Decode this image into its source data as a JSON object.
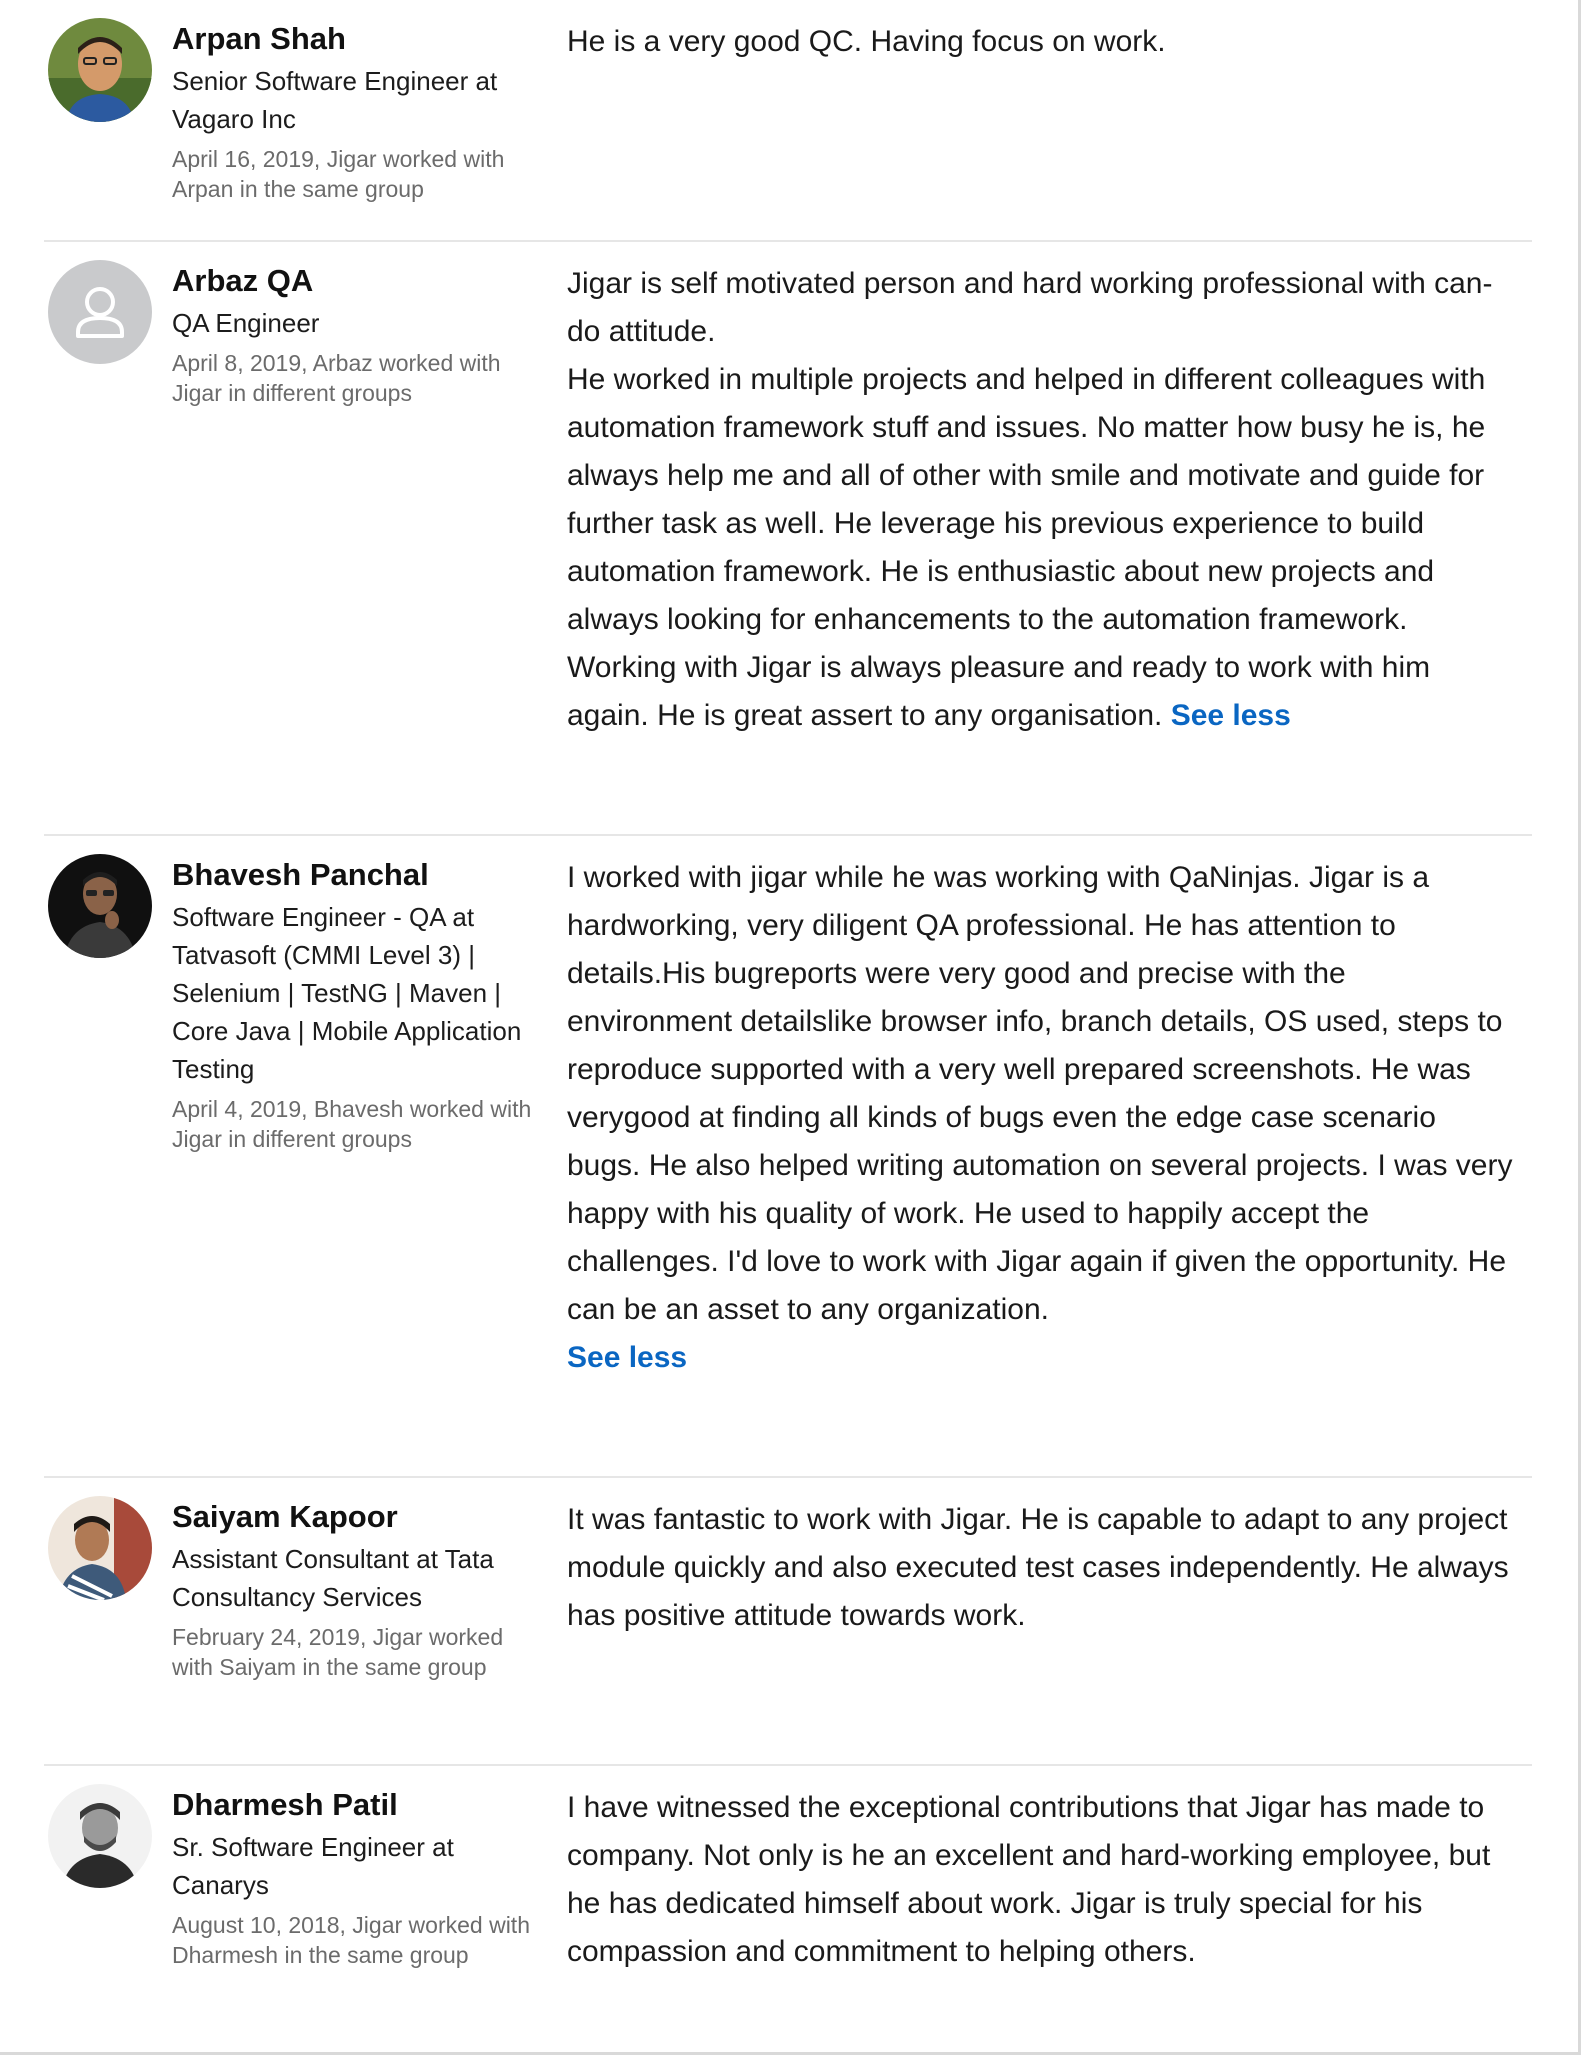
{
  "recommendations": [
    {
      "name": "Arpan Shah",
      "title": "Senior Software Engineer at Vagaro Inc",
      "date_line": "April 16, 2019, Jigar worked with Arpan in the same group",
      "avatar_icon": "person-photo",
      "text": [
        "He is a very good QC. Having focus on work."
      ],
      "see_less": ""
    },
    {
      "name": "Arbaz QA",
      "title": "QA Engineer",
      "date_line": "April 8, 2019, Arbaz worked with Jigar in different groups",
      "avatar_icon": "default-person-icon",
      "text": [
        "Jigar is self motivated person and hard working professional with can-do attitude.",
        "He worked in multiple projects and helped in different colleagues with automation framework stuff and issues. No matter how busy he is, he always help me and all of other with smile and motivate and guide for further task as well. He leverage his previous experience to build automation framework. He is enthusiastic about new projects and always looking for enhancements to the automation framework. Working with Jigar is always pleasure and ready to work with him again. He is great assert to any organisation."
      ],
      "see_less": "See less"
    },
    {
      "name": "Bhavesh Panchal",
      "title": "Software Engineer - QA at Tatvasoft (CMMI Level 3) | Selenium | TestNG | Maven | Core Java | Mobile Application Testing",
      "date_line": "April 4, 2019, Bhavesh worked with Jigar in different groups",
      "avatar_icon": "person-photo",
      "text": [
        "I worked with jigar while he was working with QaNinjas. Jigar is a hardworking, very diligent QA professional. He has attention to details.His bugreports were very good and precise with the environment detailslike browser info, branch details, OS used, steps to reproduce supported with a very well prepared screenshots. He was verygood at finding all kinds of bugs even the edge case scenario bugs. He also helped writing automation on several projects. I was very happy with his quality of work. He used to happily accept the challenges. I'd love to work with Jigar again if given the opportunity. He can be an asset to any organization."
      ],
      "see_less": "See less"
    },
    {
      "name": "Saiyam Kapoor",
      "title": "Assistant Consultant at Tata Consultancy Services",
      "date_line": "February 24, 2019, Jigar worked with Saiyam in the same group",
      "avatar_icon": "person-photo",
      "text": [
        "It was fantastic to work with Jigar. He is capable to adapt to any project module quickly and also executed test cases independently. He always has positive attitude towards work."
      ],
      "see_less": ""
    },
    {
      "name": "Dharmesh Patil",
      "title": "Sr. Software Engineer at Canarys",
      "date_line": "August 10, 2018, Jigar worked with Dharmesh in the same group",
      "avatar_icon": "person-photo",
      "text": [
        "I have witnessed the exceptional contributions that Jigar has made to company. Not only is he an excellent and hard-working employee, but he has dedicated himself about work. Jigar is truly special for his compassion and commitment to helping others."
      ],
      "see_less": ""
    }
  ]
}
